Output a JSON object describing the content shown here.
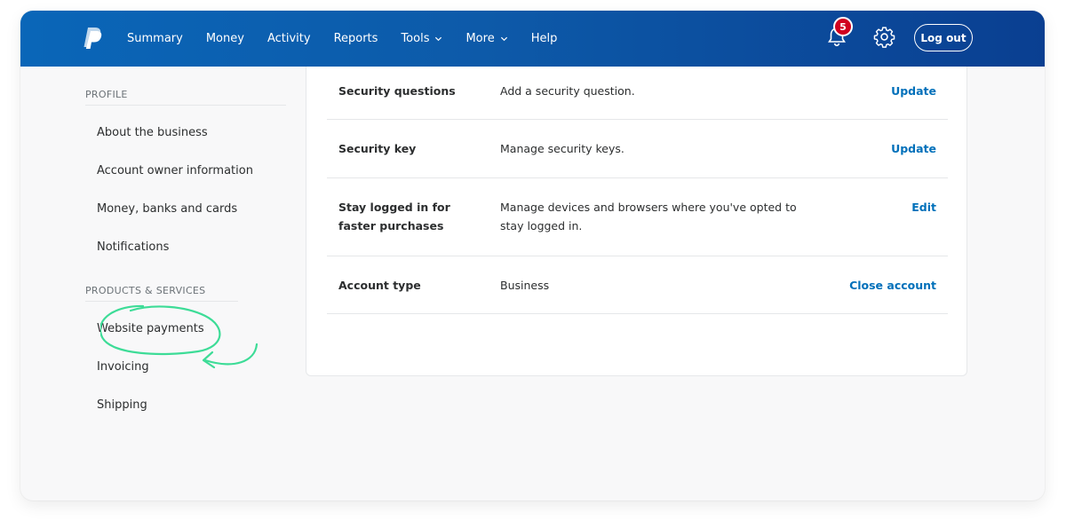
{
  "nav": {
    "logo_icon": "paypal-logo",
    "links": [
      {
        "label": "Summary"
      },
      {
        "label": "Money"
      },
      {
        "label": "Activity"
      },
      {
        "label": "Reports"
      },
      {
        "label": "Tools",
        "dropdown": true
      },
      {
        "label": "More",
        "dropdown": true
      },
      {
        "label": "Help"
      }
    ],
    "notifications_count": "5",
    "notifications_icon": "bell-icon",
    "settings_icon": "gear-icon",
    "logout_label": "Log out"
  },
  "sidebar": {
    "profile_heading": "PROFILE",
    "profile_items": [
      {
        "label": "About the business"
      },
      {
        "label": "Account owner information"
      },
      {
        "label": "Money, banks and cards"
      },
      {
        "label": "Notifications"
      }
    ],
    "products_heading": "PRODUCTS & SERVICES",
    "products_items": [
      {
        "label": "Website payments",
        "highlighted": true
      },
      {
        "label": "Invoicing"
      },
      {
        "label": "Shipping"
      }
    ]
  },
  "settings_rows": [
    {
      "label": "Security questions",
      "description": "Add a security question.",
      "action": "Update"
    },
    {
      "label": "Security key",
      "description": "Manage security keys.",
      "action": "Update"
    },
    {
      "label": "Stay logged in for faster purchases",
      "description": "Manage devices and browsers where you've opted to stay logged in.",
      "action": "Edit"
    },
    {
      "label": "Account type",
      "description": "Business",
      "action": "Close account"
    }
  ],
  "colors": {
    "nav_gradient_start": "#0a66b8",
    "nav_gradient_end": "#0a3f91",
    "link_blue": "#0070ba",
    "badge_red": "#d1001f",
    "annotation_green": "#3ddc97"
  }
}
